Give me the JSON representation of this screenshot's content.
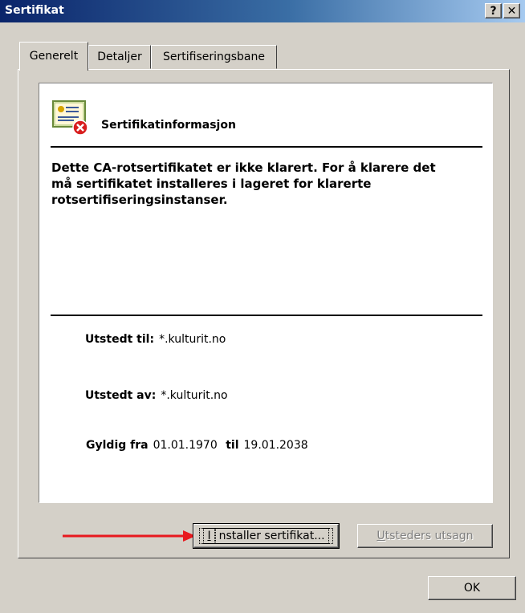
{
  "window": {
    "title": "Sertifikat"
  },
  "titlebar": {
    "help_glyph": "?",
    "close_glyph": "✕"
  },
  "tabs": [
    {
      "label": "Generelt",
      "active": true
    },
    {
      "label": "Detaljer",
      "active": false
    },
    {
      "label": "Sertifiseringsbane",
      "active": false
    }
  ],
  "info": {
    "icon": "certificate-error-icon",
    "title": "Sertifikatinformasjon",
    "warning": "Dette CA-rotsertifikatet er ikke klarert. For å klarere det må sertifikatet installeres i lageret for klarerte rotsertifiseringsinstanser.",
    "issued_to_label": "Utstedt til:",
    "issued_to_value": "*.kulturit.no",
    "issued_by_label": "Utstedt av:",
    "issued_by_value": "*.kulturit.no",
    "valid_from_label": "Gyldig fra",
    "valid_from_value": "01.01.1970",
    "valid_until_label": "til",
    "valid_until_value": "19.01.2038"
  },
  "buttons": {
    "install_mnemonic": "I",
    "install_rest": "nstaller sertifikat...",
    "issuer_mnemonic": "U",
    "issuer_rest": "tsteders utsagn",
    "ok": "OK"
  },
  "colors": {
    "arrow": "#e8191e",
    "title_start": "#0a246a",
    "title_end": "#a6caf0"
  }
}
